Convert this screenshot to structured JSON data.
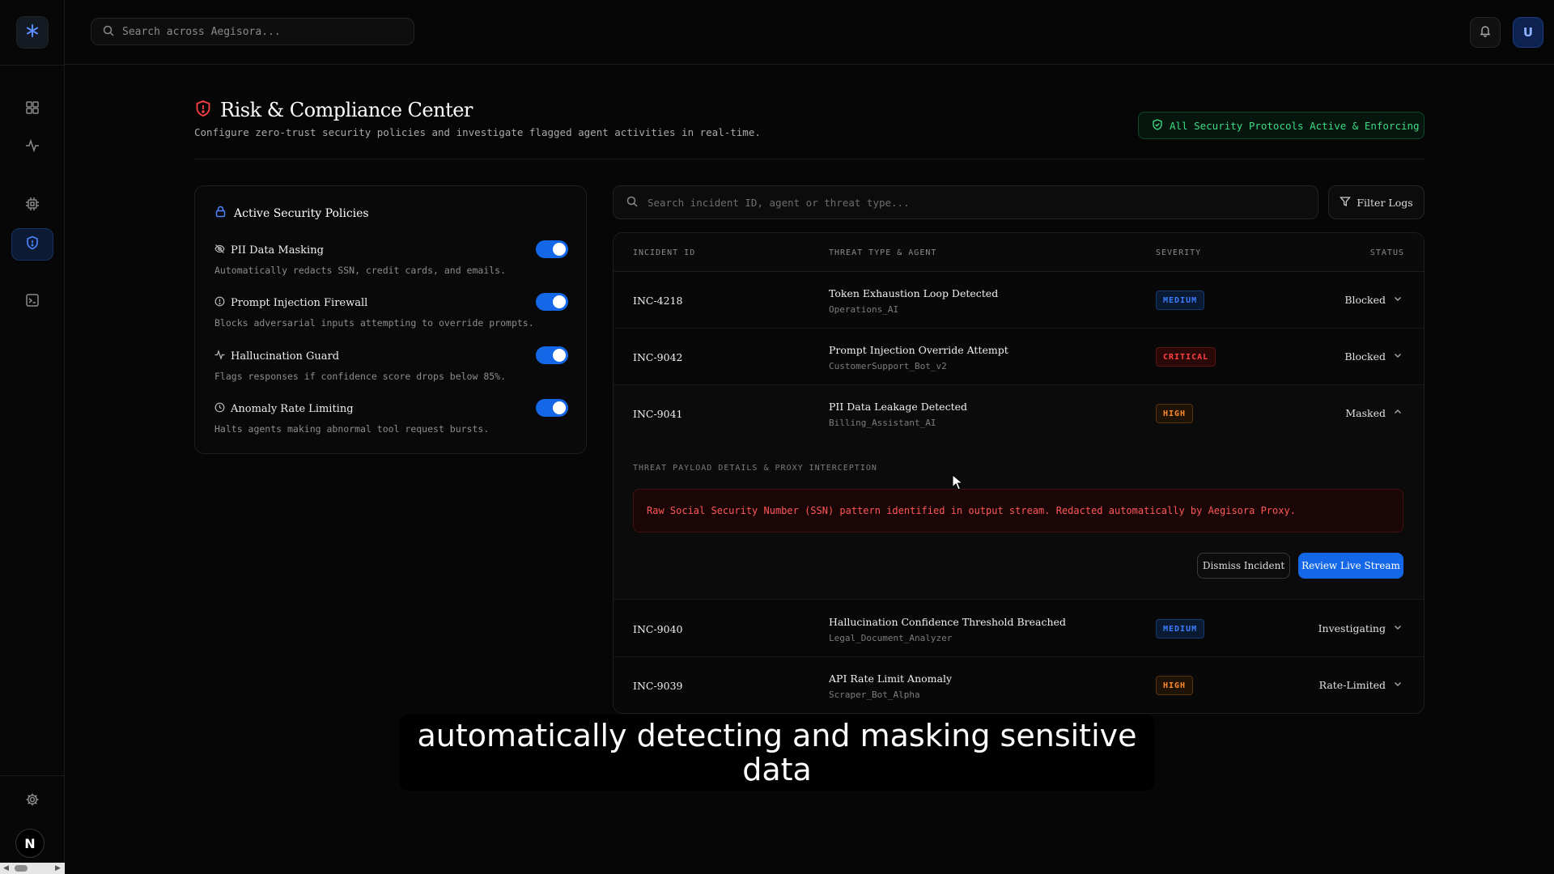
{
  "sidebar": {
    "logo_icon": "asterisk-logo-icon",
    "nav": [
      {
        "name": "dashboard",
        "icon": "grid-icon"
      },
      {
        "name": "activity",
        "icon": "pulse-icon"
      },
      {
        "name": "agents",
        "icon": "chip-icon"
      },
      {
        "name": "security",
        "icon": "shield-icon",
        "active": true
      },
      {
        "name": "terminal",
        "icon": "terminal-icon"
      }
    ],
    "settings_icon": "gear-icon",
    "avatar_initial": "N"
  },
  "topbar": {
    "search_placeholder": "Search across Aegisora...",
    "user_initial": "U"
  },
  "header": {
    "title": "Risk & Compliance Center",
    "subtitle": "Configure zero-trust security policies and investigate flagged agent activities in real-time.",
    "status_badge": "All Security Protocols Active & Enforcing"
  },
  "policies": {
    "title": "Active Security Policies",
    "items": [
      {
        "name": "PII Data Masking",
        "description": "Automatically redacts SSN, credit cards, and emails.",
        "icon": "eye-off-icon",
        "enabled": true
      },
      {
        "name": "Prompt Injection Firewall",
        "description": "Blocks adversarial inputs attempting to override prompts.",
        "icon": "alert-circle-icon",
        "enabled": true
      },
      {
        "name": "Hallucination Guard",
        "description": "Flags responses if confidence score drops below 85%.",
        "icon": "pulse-icon",
        "enabled": true
      },
      {
        "name": "Anomaly Rate Limiting",
        "description": "Halts agents making abnormal tool request bursts.",
        "icon": "clock-icon",
        "enabled": true
      }
    ]
  },
  "incidents": {
    "search_placeholder": "Search incident ID, agent or threat type...",
    "filter_label": "Filter Logs",
    "columns": [
      "INCIDENT ID",
      "THREAT TYPE & AGENT",
      "SEVERITY",
      "STATUS"
    ],
    "rows": [
      {
        "id": "INC-4218",
        "threat": "Token Exhaustion Loop Detected",
        "agent": "Operations_AI",
        "severity": "MEDIUM",
        "status": "Blocked",
        "expanded": false
      },
      {
        "id": "INC-9042",
        "threat": "Prompt Injection Override Attempt",
        "agent": "CustomerSupport_Bot_v2",
        "severity": "CRITICAL",
        "status": "Blocked",
        "expanded": false
      },
      {
        "id": "INC-9041",
        "threat": "PII Data Leakage Detected",
        "agent": "Billing_Assistant_AI",
        "severity": "HIGH",
        "status": "Masked",
        "expanded": true
      },
      {
        "id": "INC-9040",
        "threat": "Hallucination Confidence Threshold Breached",
        "agent": "Legal_Document_Analyzer",
        "severity": "MEDIUM",
        "status": "Investigating",
        "expanded": false
      },
      {
        "id": "INC-9039",
        "threat": "API Rate Limit Anomaly",
        "agent": "Scraper_Bot_Alpha",
        "severity": "HIGH",
        "status": "Rate-Limited",
        "expanded": false
      }
    ],
    "detail": {
      "label": "THREAT PAYLOAD DETAILS & PROXY INTERCEPTION",
      "message": "Raw Social Security Number (SSN) pattern identified in output stream. Redacted automatically by Aegisora Proxy.",
      "dismiss_label": "Dismiss Incident",
      "review_label": "Review Live Stream"
    }
  },
  "caption": "automatically detecting and masking sensitive data",
  "colors": {
    "accent": "#1468e8",
    "success": "#3ddc84",
    "critical": "#ff4141",
    "high": "#ff8a2a",
    "medium": "#3d7dff"
  }
}
